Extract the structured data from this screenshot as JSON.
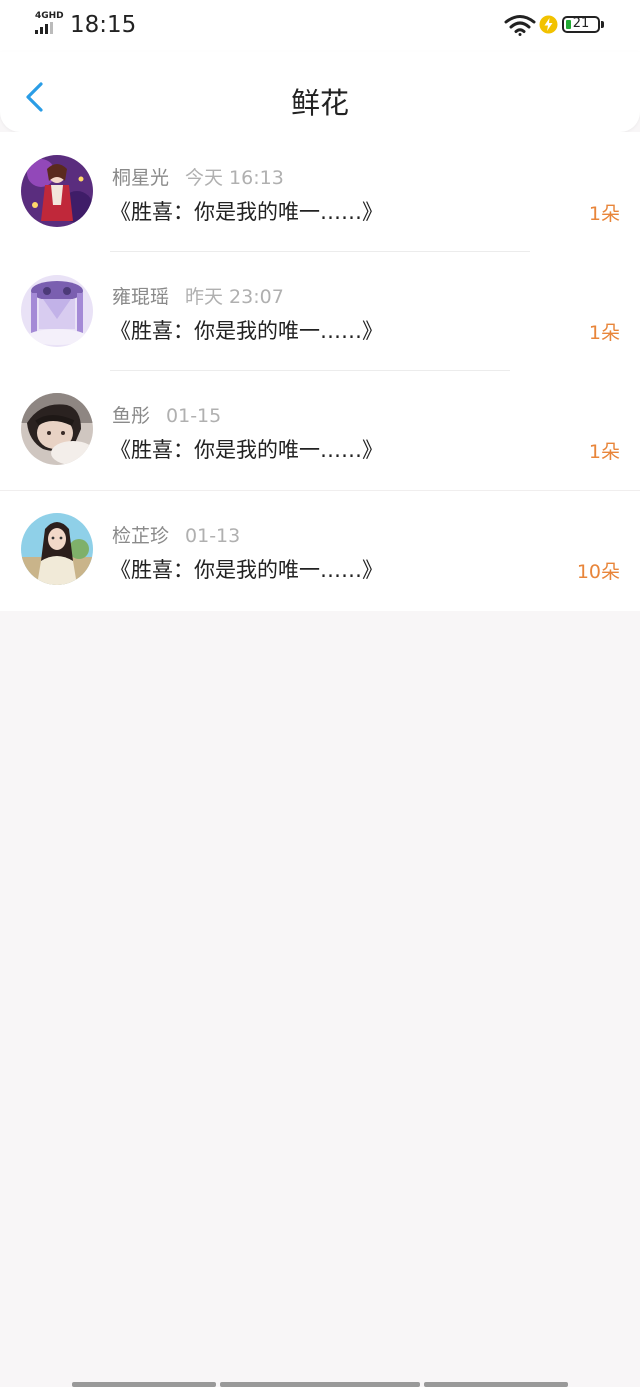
{
  "status_bar": {
    "network": "4GHD",
    "time": "18:15",
    "battery": "21",
    "accent": "#22aa33",
    "charging_color": "#f2c200"
  },
  "header": {
    "title": "鲜花",
    "back_icon": "chevron-left-icon",
    "accent": "#2a9de6"
  },
  "flowers": [
    {
      "name": "桐星光",
      "time": "今天 16:13",
      "message": "《胜喜：你是我的唯一……》",
      "count": "1朵"
    },
    {
      "name": "雍琨瑶",
      "time": "昨天 23:07",
      "message": "《胜喜：你是我的唯一……》",
      "count": "1朵"
    },
    {
      "name": "鱼彤",
      "time": "01-15",
      "message": "《胜喜：你是我的唯一……》",
      "count": "1朵"
    },
    {
      "name": "检芷珍",
      "time": "01-13",
      "message": "《胜喜：你是我的唯一……》",
      "count": "10朵"
    }
  ],
  "colors": {
    "count": "#e8853a",
    "background": "#f8f6f7"
  }
}
